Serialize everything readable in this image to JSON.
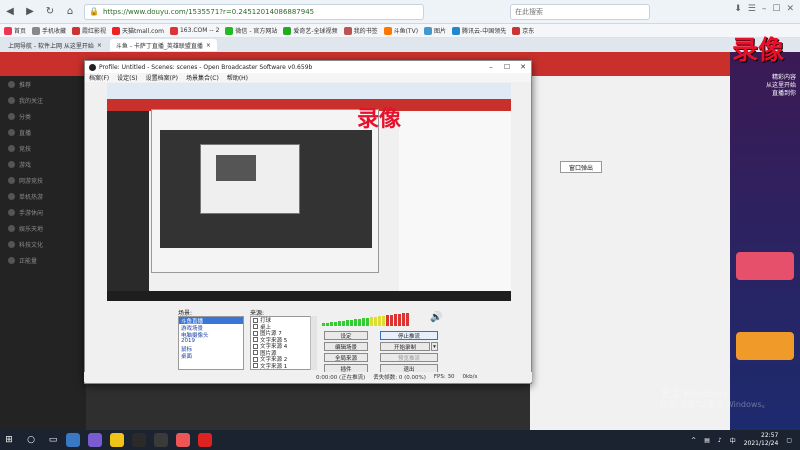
{
  "browser": {
    "url": "https://www.douyu.com/1535571?r=0.24512014086887945",
    "search_placeholder": "在此搜索",
    "bookmarks": [
      {
        "label": "首页",
        "color": "#e35"
      },
      {
        "label": "手机收藏",
        "color": "#888"
      },
      {
        "label": "霞红影视",
        "color": "#c33"
      },
      {
        "label": "天猫tmall.com",
        "color": "#e22"
      },
      {
        "label": "163.COM -- 2",
        "color": "#d33"
      },
      {
        "label": "微信 - 官方网站",
        "color": "#2b2"
      },
      {
        "label": "爱奇艺-全球视频",
        "color": "#2a2"
      },
      {
        "label": "我的书签",
        "color": "#b55"
      },
      {
        "label": "斗鱼(TV)",
        "color": "#f70"
      },
      {
        "label": "图片",
        "color": "#49c"
      },
      {
        "label": "腾讯云-中国领先",
        "color": "#28c"
      },
      {
        "label": "京东",
        "color": "#c33"
      }
    ],
    "tabs": [
      {
        "label": "上网导航 - 软件上网 从这里开始"
      },
      {
        "label": "斗鱼 - 卡萨丁直播_英雄联盟直播",
        "active": true
      }
    ]
  },
  "douyu": {
    "sidebar_items": [
      "推荐",
      "我的关注",
      "分类",
      "直播",
      "竞技",
      "游戏",
      "网游竞技",
      "单机热游",
      "手游休闲",
      "娱乐天地",
      "科技文化",
      "正能量"
    ],
    "stamp": "录像",
    "stamp_sub": "精彩内容\n从这里开始\n直播到你"
  },
  "obs": {
    "title": "Profile: Untitled - Scenes: scenes - Open Broadcaster Software v0.659b",
    "menu": [
      "档案(F)",
      "设定(S)",
      "设置档案(P)",
      "场景集合(C)",
      "帮助(H)"
    ],
    "popout_label": "窗口弹出",
    "scenes_label": "场景:",
    "sources_label": "来源:",
    "scenes": [
      "斗鱼直播",
      "游戏场景",
      "电脑摄像头",
      "2019",
      "鼠标",
      "桌面"
    ],
    "selected_scene": 0,
    "sources": [
      "打球",
      "桌上",
      "图片源 7",
      "文字来源 5",
      "文字来源 4",
      "图片源",
      "文字来源 2",
      "文字来源 1"
    ],
    "buttons": {
      "settings": "设定",
      "start_stream": "停止推流",
      "edit_scene": "编辑场景",
      "start_record": "开始录制",
      "global_sources": "全局来源",
      "preview": "预览推流",
      "plugins": "插件",
      "exit": "退出"
    },
    "status": {
      "time": "0:00:00 (正在推流)",
      "dropped": "丢失帧数: 0 (0.00%)",
      "fps": "FPS: 30",
      "bitrate": "0kb/s"
    }
  },
  "taskbar": {
    "time": "22:57",
    "date": "2021/12/24",
    "lang": "中",
    "apps": [
      "#3a78c4",
      "#7a5bd1",
      "#f0c419",
      "#2a2a2a",
      "#3a3a3a",
      "#e55",
      "#d22"
    ]
  },
  "watermark": {
    "line1": "激活 Windows",
    "line2": "转到\"设置\"以激活 Windows。"
  }
}
